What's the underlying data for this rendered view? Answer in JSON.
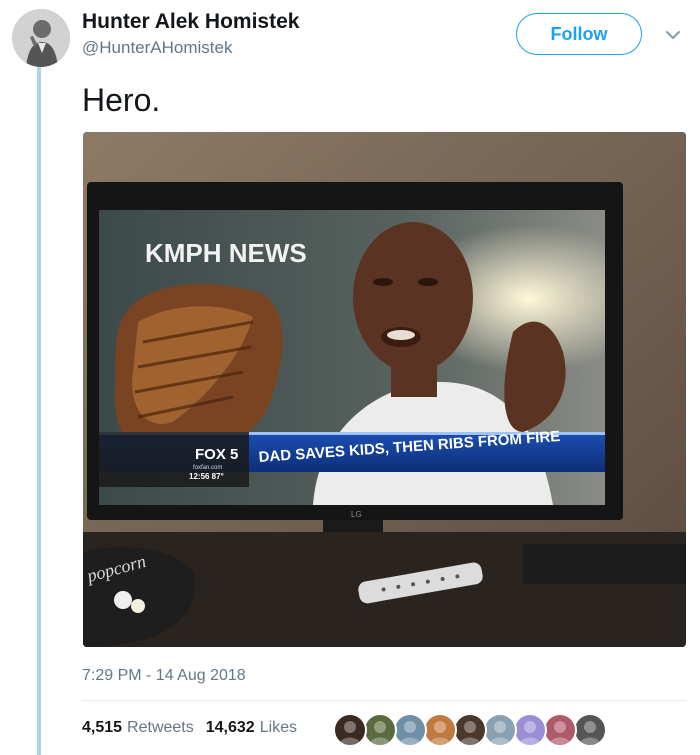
{
  "author": {
    "name": "Hunter Alek Homistek",
    "handle": "@HunterAHomistek",
    "avatar_icon": "user-avatar"
  },
  "follow_label": "Follow",
  "tweet": {
    "text": "Hero.",
    "timestamp": "7:29 PM - 14 Aug 2018"
  },
  "media": {
    "station_logo": "KMPH NEWS",
    "channel_logo": "FOX 5",
    "channel_sub": "foxfan.com",
    "clock": "12:56  87°",
    "headline": "DAD SAVES KIDS, THEN RIBS FROM FIRE",
    "tv_brand": "LG",
    "bag_text": "popcorn"
  },
  "stats": {
    "retweets_count": "4,515",
    "retweets_label": "Retweets",
    "likes_count": "14,632",
    "likes_label": "Likes"
  },
  "liker_colors": [
    "#3a2a24",
    "#5a6b3e",
    "#6f8fa6",
    "#c0793e",
    "#4b3a2c",
    "#8aa0b3",
    "#9a8fd6",
    "#b0596a",
    "#555555"
  ],
  "colors": {
    "accent": "#1da1f2",
    "thread": "#a8d4f2",
    "secondary_text": "#657786"
  }
}
